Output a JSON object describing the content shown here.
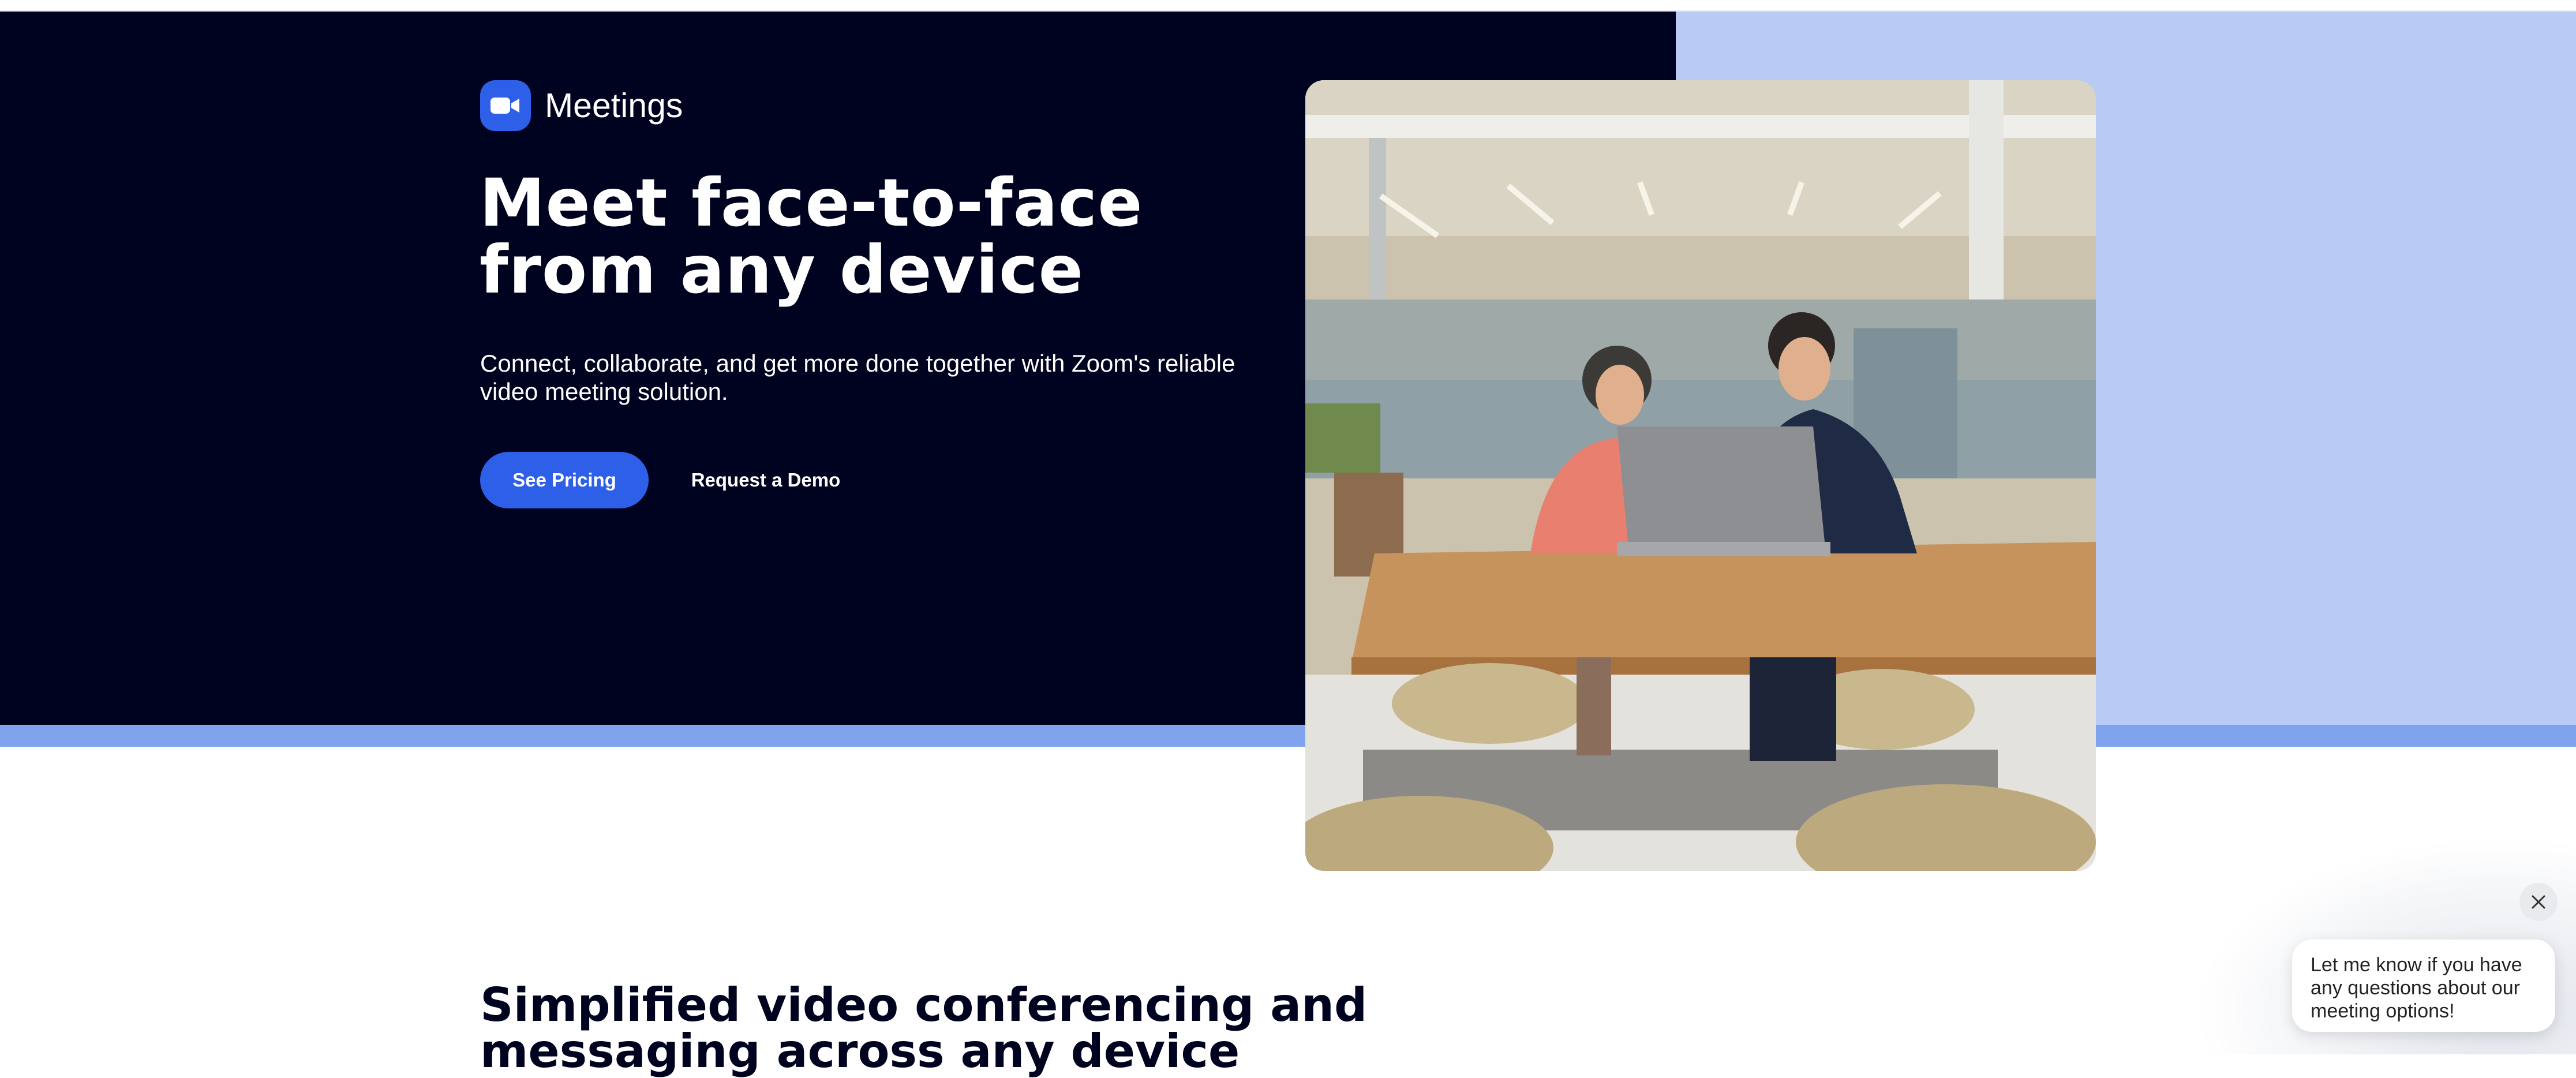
{
  "product": {
    "name": "Meetings",
    "logo_icon": "video-camera-icon"
  },
  "hero": {
    "headline": "Meet face-to-face from any device",
    "subtitle": "Connect, collaborate, and get more done together with Zoom's reliable video meeting solution.",
    "primary_button": "See Pricing",
    "secondary_button": "Request a Demo",
    "image": "photo-two-colleagues-at-laptop"
  },
  "section": {
    "title": "Simplified video conferencing and messaging across any device"
  },
  "chat": {
    "message": "Let me know if you have any questions about our meeting options!",
    "close_icon": "close-icon"
  },
  "colors": {
    "hero_dark": "#00031f",
    "hero_light": "#b8cbf4",
    "accent_blue": "#2d5fe8",
    "band_blue": "#7fa3ec"
  }
}
